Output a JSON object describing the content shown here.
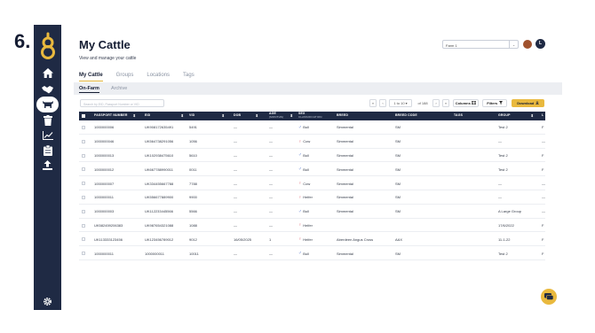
{
  "step_number": "6.",
  "colors": {
    "sidebar": "#1f2a44",
    "accent": "#e9b93e",
    "male": "#3a62c9",
    "female": "#e06a78"
  },
  "sidebar": {
    "logo": "app-logo",
    "items": [
      {
        "icon": "home-icon"
      },
      {
        "icon": "handshake-icon"
      },
      {
        "icon": "cow-icon",
        "active": true
      },
      {
        "icon": "trash-icon"
      },
      {
        "icon": "chart-icon"
      },
      {
        "icon": "clipboard-icon"
      },
      {
        "icon": "upload-icon"
      }
    ],
    "settings_icon": "gear-icon"
  },
  "header": {
    "title": "My Cattle",
    "subtitle": "View and manage your cattle",
    "farm_select_value": "Farm 1",
    "avatar_initial": "L"
  },
  "tabs": [
    "My Cattle",
    "Groups",
    "Locations",
    "Tags"
  ],
  "subtabs": [
    "On-Farm",
    "Archive"
  ],
  "toolbar": {
    "search_placeholder": "Search by EID, Passport Number or VID",
    "page_range": "1 to 10",
    "page_total": "of 188",
    "columns_label": "Columns",
    "filters_label": "Filters",
    "download_label": "Download"
  },
  "table": {
    "headers": {
      "passport": "PASSPORT NUMBER",
      "eid": "EID",
      "vid": "VID",
      "dob": "DOB",
      "age": "AGE",
      "age_sub": "(MONTHS)",
      "sex": "SEX",
      "sex_sub": "CLASSIFICATION",
      "breed": "BREED",
      "breed_code": "BREED CODE",
      "tags": "TAGS",
      "group": "GROUP",
      "more": "L"
    },
    "rows": [
      {
        "passport": "1000000006",
        "eid": "UK908172635491",
        "vid": "5491",
        "dob": "—",
        "age": "—",
        "sex": "Bull",
        "male": true,
        "breed": "Simmental",
        "breed_code": "SM",
        "tags": "",
        "group": "Test 2",
        "more": "F"
      },
      {
        "passport": "1000000046",
        "eid": "UK564738291056",
        "vid": "1056",
        "dob": "—",
        "age": "—",
        "sex": "Cow",
        "male": false,
        "breed": "Simmental",
        "breed_code": "SM",
        "tags": "",
        "group": "—",
        "more": "—"
      },
      {
        "passport": "1000000013",
        "eid": "UK102938475610",
        "vid": "5610",
        "dob": "—",
        "age": "—",
        "sex": "Bull",
        "male": true,
        "breed": "Simmental",
        "breed_code": "SM",
        "tags": "",
        "group": "Test 2",
        "more": "F"
      },
      {
        "passport": "1000000012",
        "eid": "UK667788990011",
        "vid": "0011",
        "dob": "—",
        "age": "—",
        "sex": "Bull",
        "male": true,
        "breed": "Simmental",
        "breed_code": "SM",
        "tags": "",
        "group": "Test 2",
        "more": "F"
      },
      {
        "passport": "1000000007",
        "eid": "UK334455667788",
        "vid": "7788",
        "dob": "—",
        "age": "—",
        "sex": "Cow",
        "male": false,
        "breed": "Simmental",
        "breed_code": "SM",
        "tags": "",
        "group": "—",
        "more": "—"
      },
      {
        "passport": "1000000011",
        "eid": "UK556677889900",
        "vid": "9900",
        "dob": "—",
        "age": "—",
        "sex": "Heifer",
        "male": false,
        "breed": "Simmental",
        "breed_code": "SM",
        "tags": "",
        "group": "—",
        "more": "—"
      },
      {
        "passport": "1000000003",
        "eid": "UK112233445566",
        "vid": "5566",
        "dob": "—",
        "age": "—",
        "sex": "Bull",
        "male": true,
        "breed": "Simmental",
        "breed_code": "SM",
        "tags": "",
        "group": "A Large Group",
        "more": "—"
      },
      {
        "passport": "UK582459206383",
        "eid": "UK987654321088",
        "vid": "1088",
        "dob": "—",
        "age": "—",
        "sex": "Heifer",
        "male": false,
        "breed": "",
        "breed_code": "",
        "tags": "",
        "group": "17/6/2022",
        "more": "F"
      },
      {
        "passport": "UK113333123456",
        "eid": "UK123456789012",
        "vid": "9012",
        "dob": "16/05/2025",
        "age": "1",
        "sex": "Heifer",
        "male": false,
        "breed": "Aberdeen Angus Cross",
        "breed_code": "AAX",
        "tags": "",
        "group": "11-1-22",
        "more": "F"
      },
      {
        "passport": "1000000011",
        "eid": "1000000011",
        "vid": "10011",
        "dob": "—",
        "age": "—",
        "sex": "Bull",
        "male": true,
        "breed": "Simmental",
        "breed_code": "SM",
        "tags": "",
        "group": "Test 2",
        "more": "F"
      }
    ]
  },
  "chat_icon": "chat-icon"
}
